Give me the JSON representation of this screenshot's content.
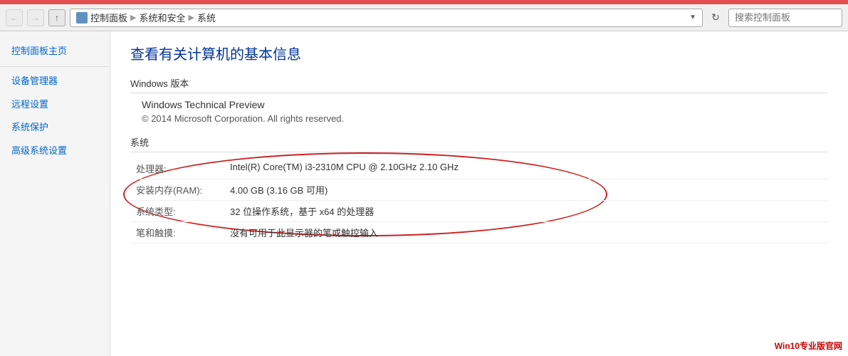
{
  "topbar": {
    "nav_back_label": "←",
    "nav_forward_label": "→",
    "nav_up_label": "↑",
    "refresh_label": "↻",
    "path": {
      "part1": "控制面板",
      "part2": "系统和安全",
      "part3": "系统"
    },
    "search_placeholder": "搜索控制面板"
  },
  "sidebar": {
    "items": [
      {
        "label": "控制面板主页"
      },
      {
        "label": "设备管理器"
      },
      {
        "label": "远程设置"
      },
      {
        "label": "系统保护"
      },
      {
        "label": "高级系统设置"
      }
    ]
  },
  "content": {
    "page_title": "查看有关计算机的基本信息",
    "windows_section_label": "Windows 版本",
    "windows_version": "Windows Technical Preview",
    "windows_copyright": "© 2014 Microsoft Corporation. All rights reserved.",
    "system_section_label": "系统",
    "system_rows": [
      {
        "label": "处理器:",
        "value": "Intel(R) Core(TM) i3-2310M CPU @ 2.10GHz   2.10 GHz"
      },
      {
        "label": "安装内存(RAM):",
        "value": "4.00 GB (3.16 GB 可用)"
      },
      {
        "label": "系统类型:",
        "value": "32 位操作系统，基于 x64 的处理器"
      },
      {
        "label": "笔和触摸:",
        "value": "没有可用于此显示器的笔或触控输入"
      }
    ]
  },
  "watermark": {
    "text": "Win10专业版官网"
  }
}
